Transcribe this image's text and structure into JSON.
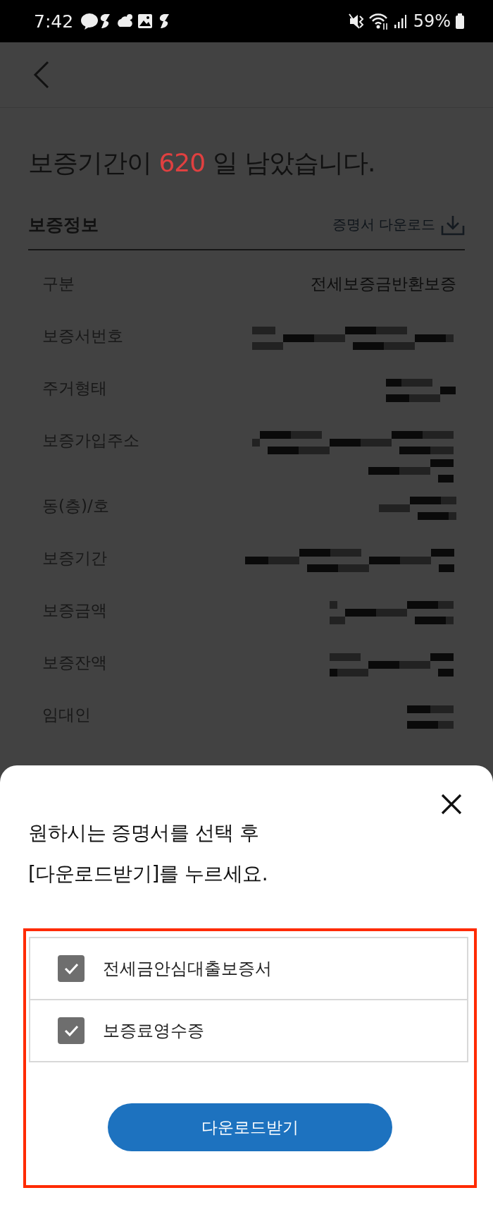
{
  "status_bar": {
    "time": "7:42",
    "battery": "59%"
  },
  "title": {
    "prefix": "보증기간이",
    "days": "620",
    "suffix": "일 남았습니다."
  },
  "section": {
    "title": "보증정보",
    "download_link": "증명서 다운로드"
  },
  "rows": [
    {
      "label": "구분",
      "value": "전세보증금반환보증",
      "redacted": false
    },
    {
      "label": "보증서번호",
      "redacted": true
    },
    {
      "label": "주거형태",
      "redacted": true
    },
    {
      "label": "보증가입주소",
      "redacted": true
    },
    {
      "label": "동(층)/호",
      "redacted": true
    },
    {
      "label": "보증기간",
      "redacted": true
    },
    {
      "label": "보증금액",
      "redacted": true
    },
    {
      "label": "보증잔액",
      "redacted": true
    },
    {
      "label": "임대인",
      "redacted": true
    }
  ],
  "sheet": {
    "message_lines": [
      "원하시는 증명서를 선택 후",
      "[다운로드받기]를 누르세요."
    ],
    "options": [
      {
        "label": "전세금안심대출보증서",
        "checked": true
      },
      {
        "label": "보증료영수증",
        "checked": true
      }
    ],
    "button": "다운로드받기"
  }
}
